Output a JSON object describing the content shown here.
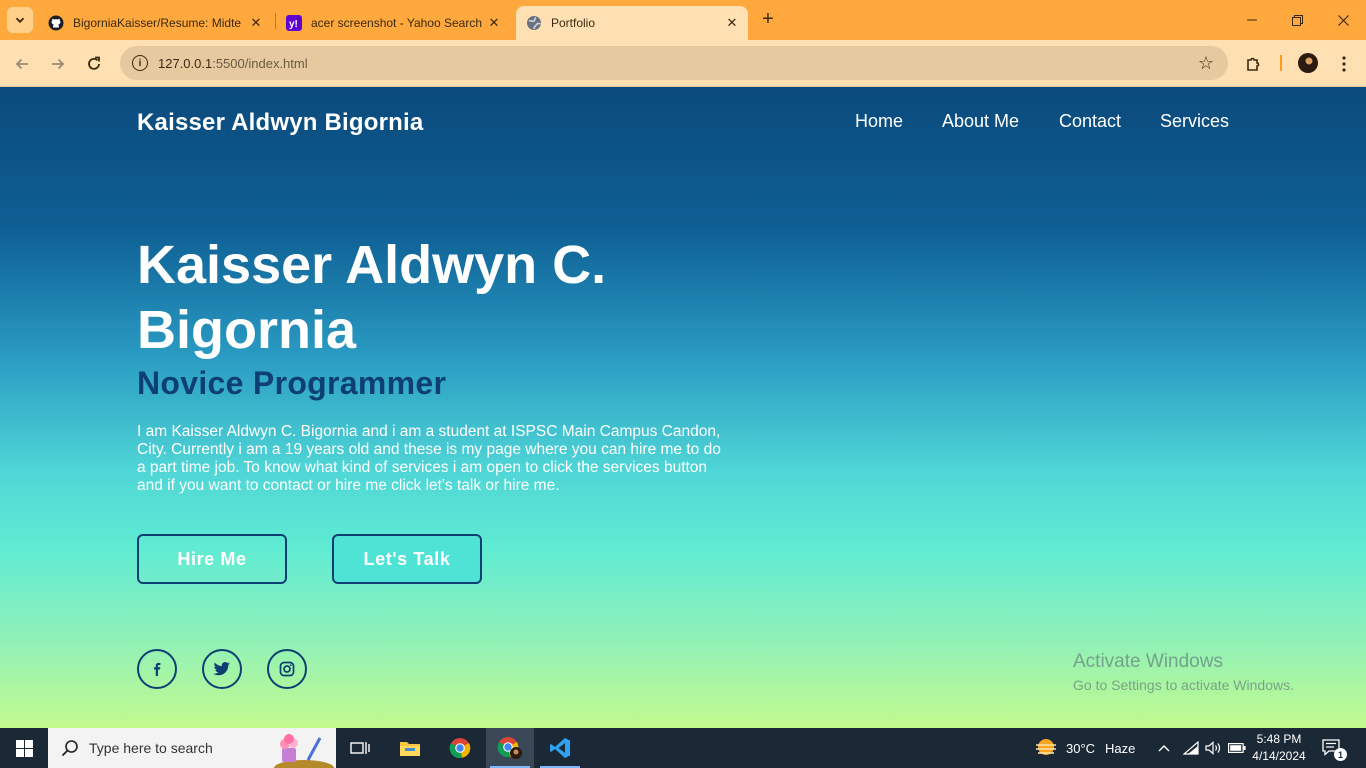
{
  "browser": {
    "tabs": [
      {
        "title": "BigorniaKaisser/Resume: Midte",
        "favicon": "github-icon",
        "active": false
      },
      {
        "title": "acer screenshot - Yahoo Search",
        "favicon": "yahoo-icon",
        "active": false
      },
      {
        "title": "Portfolio",
        "favicon": "globe-icon",
        "active": true
      }
    ],
    "url_host": "127.0.0.1",
    "url_path": ":5500/index.html"
  },
  "page": {
    "logo": "Kaisser Aldwyn Bigornia",
    "nav": [
      "Home",
      "About Me",
      "Contact",
      "Services"
    ],
    "hero_name": "Kaisser Aldwyn C. Bigornia",
    "hero_role": "Novice Programmer",
    "hero_description": "I am Kaisser Aldwyn C. Bigornia and i am a student at ISPSC Main Campus Candon, City. Currently i am a 19 years old and these is my page where you can hire me to do a part time job. To know what kind of services i am open to click the services button and if you want to contact or hire me click let's talk or hire me.",
    "buttons": {
      "hire": "Hire Me",
      "talk": "Let's Talk"
    },
    "socials": [
      "facebook-icon",
      "twitter-icon",
      "instagram-icon"
    ],
    "watermark": {
      "title": "Activate Windows",
      "subtitle": "Go to Settings to activate Windows."
    }
  },
  "taskbar": {
    "search_placeholder": "Type here to search",
    "weather_temp": "30°C",
    "weather_desc": "Haze",
    "time": "5:48 PM",
    "date": "4/14/2024",
    "notification_count": "1"
  },
  "colors": {
    "accent_dark": "#0e3f72",
    "tabbar": "#ffa83d",
    "toolbar": "#ffe0b3"
  }
}
